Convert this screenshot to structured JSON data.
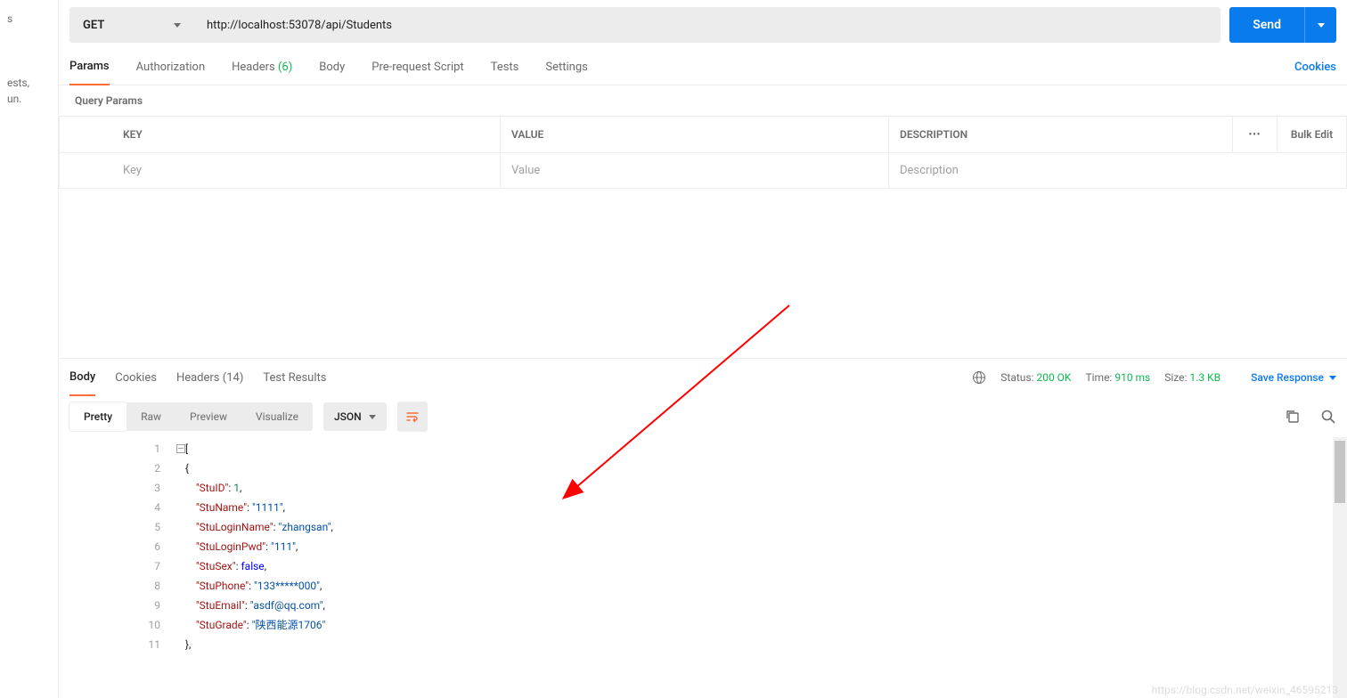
{
  "sidebar": {
    "line1": "s",
    "line2": "ests,",
    "line3": "un."
  },
  "request": {
    "method": "GET",
    "url": "http://localhost:53078/api/Students",
    "send_label": "Send"
  },
  "req_tabs": {
    "params": "Params",
    "authorization": "Authorization",
    "headers": "Headers",
    "headers_count": "(6)",
    "body": "Body",
    "prerequest": "Pre-request Script",
    "tests": "Tests",
    "settings": "Settings",
    "cookies": "Cookies"
  },
  "query": {
    "title": "Query Params",
    "cols": {
      "key": "KEY",
      "value": "VALUE",
      "desc": "DESCRIPTION",
      "bulk": "Bulk Edit"
    },
    "placeholders": {
      "key": "Key",
      "value": "Value",
      "desc": "Description"
    }
  },
  "resp_tabs": {
    "body": "Body",
    "cookies": "Cookies",
    "headers": "Headers",
    "headers_count": "(14)",
    "tests": "Test Results"
  },
  "status": {
    "status_label": "Status:",
    "status_value": "200 OK",
    "time_label": "Time:",
    "time_value": "910 ms",
    "size_label": "Size:",
    "size_value": "1.3 KB",
    "save": "Save Response"
  },
  "viewmodes": {
    "pretty": "Pretty",
    "raw": "Raw",
    "preview": "Preview",
    "visualize": "Visualize",
    "format": "JSON"
  },
  "code_lines": [
    "1",
    "2",
    "3",
    "4",
    "5",
    "6",
    "7",
    "8",
    "9",
    "10",
    "11"
  ],
  "json_body": [
    {
      "indent": 0,
      "raw": "[",
      "collapse": true
    },
    {
      "indent": 1,
      "raw": "{"
    },
    {
      "indent": 2,
      "key": "StuID",
      "num": "1",
      "comma": true
    },
    {
      "indent": 2,
      "key": "StuName",
      "str": "1111",
      "comma": true
    },
    {
      "indent": 2,
      "key": "StuLoginName",
      "str": "zhangsan",
      "comma": true
    },
    {
      "indent": 2,
      "key": "StuLoginPwd",
      "str": "111",
      "comma": true
    },
    {
      "indent": 2,
      "key": "StuSex",
      "bool": "false",
      "comma": true
    },
    {
      "indent": 2,
      "key": "StuPhone",
      "str": "133*****000",
      "comma": true
    },
    {
      "indent": 2,
      "key": "StuEmail",
      "str": "asdf@qq.com",
      "comma": true
    },
    {
      "indent": 2,
      "key": "StuGrade",
      "str": "陕西能源1706"
    },
    {
      "indent": 1,
      "raw": "},"
    }
  ],
  "watermark": "https://blog.csdn.net/weixin_46595213"
}
